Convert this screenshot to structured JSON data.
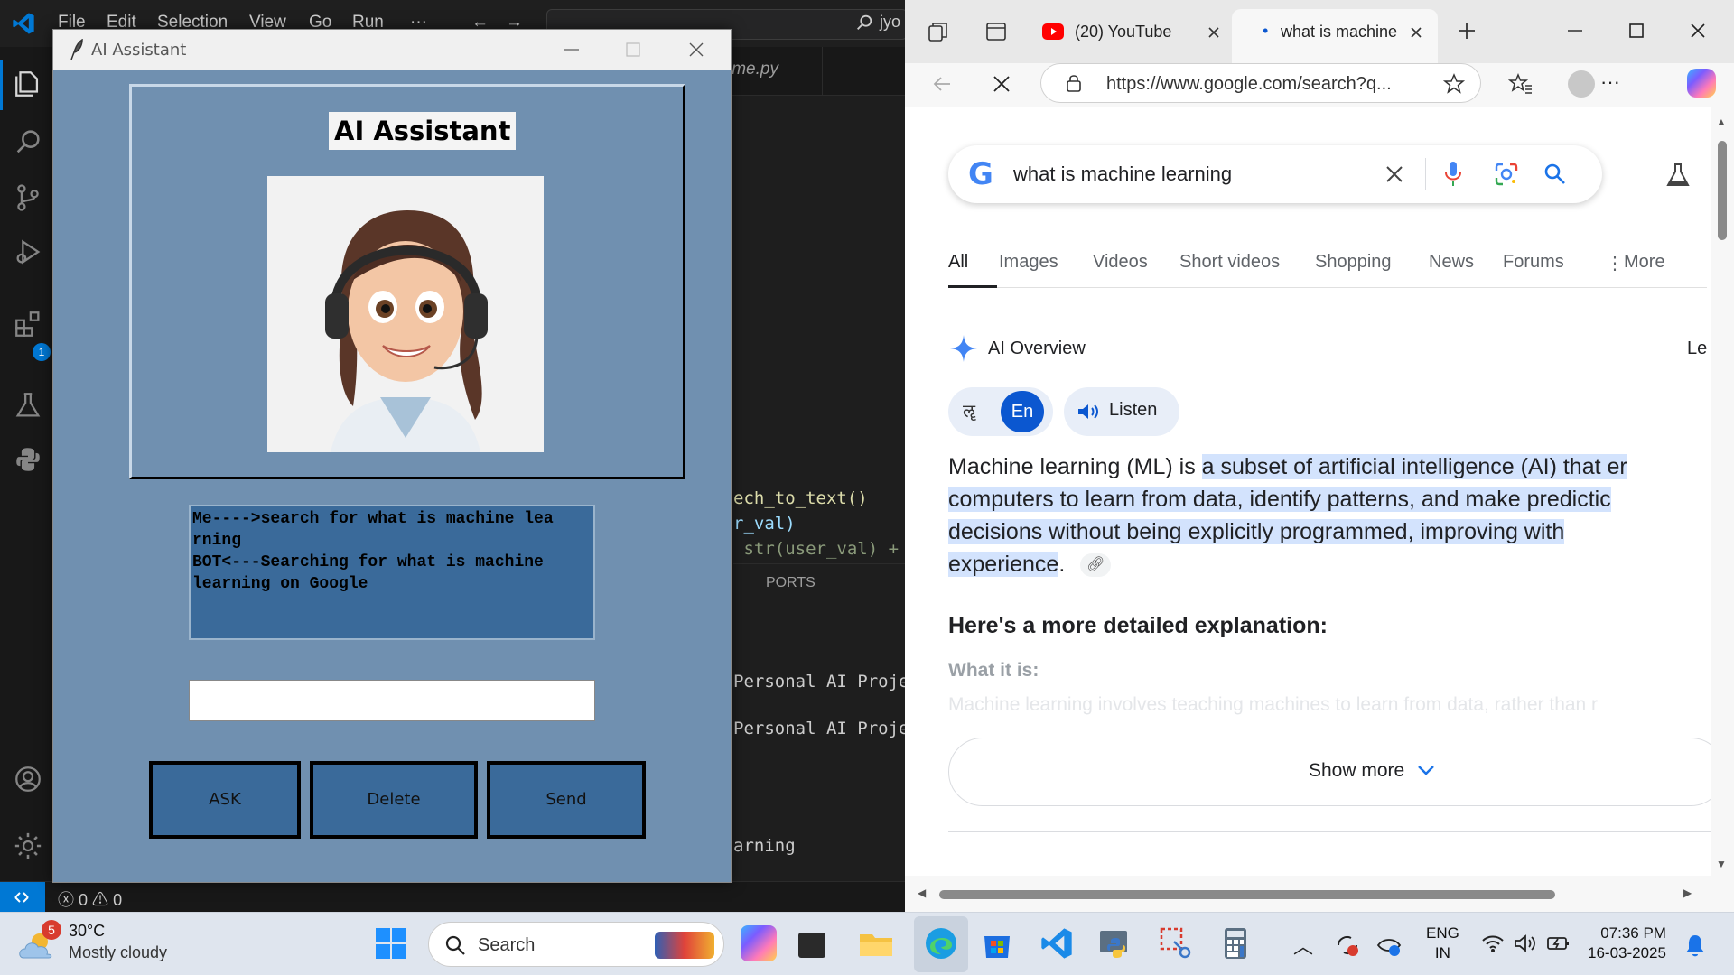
{
  "vscode": {
    "menu": [
      "File",
      "Edit",
      "Selection",
      "View",
      "Go",
      "Run",
      "···"
    ],
    "search_text": "jyo",
    "tab_file": "ime.py",
    "extensions_badge": "1",
    "code_lines": [
      {
        "text": "ech_to_text()",
        "color": "#dcdcaa"
      },
      {
        "text": "r_val)",
        "color": "#9cdcfe"
      },
      {
        "text": " str(user_val) +",
        "color": "#8a9a7a"
      }
    ],
    "panel_tab": "PORTS",
    "terminal_lines": [
      "Personal AI Projec",
      "Personal AI Projec",
      "arning"
    ],
    "status_errors": "0",
    "status_warnings": "0"
  },
  "ai_app": {
    "window_title": "AI Assistant",
    "heading": "AI Assistant",
    "chat_log": "Me---->search for what is machine lea\nrning\nBOT<---Searching for what is machine\nlearning on Google",
    "input_value": "",
    "buttons": {
      "ask": "ASK",
      "delete": "Delete",
      "send": "Send"
    }
  },
  "browser": {
    "tabs": [
      {
        "label": "(20) YouTube"
      },
      {
        "label": "what is machine"
      }
    ],
    "url": "https://www.google.com/search?q...",
    "search_query": "what is machine learning",
    "search_tabs": [
      "All",
      "Images",
      "Videos",
      "Short videos",
      "Shopping",
      "News",
      "Forums",
      "More"
    ],
    "ai_overview_title": "AI Overview",
    "ai_overview_right": "Le",
    "lang_en": "En",
    "listen": "Listen",
    "ml_plain_1": "Machine learning (ML) is ",
    "ml_hl_1": "a subset of artificial intelligence (AI) that er",
    "ml_hl_2": "computers to learn from data, identify patterns, and make predictic",
    "ml_hl_3": "decisions without being explicitly programmed, improving with",
    "ml_hl_4": "experience",
    "ml_end": ".",
    "detail_heading": "Here's a more detailed explanation:",
    "what_it_is": "What it is:",
    "faded_text": "Machine learning involves teaching machines to learn from data, rather than r",
    "show_more": "Show more"
  },
  "taskbar": {
    "weather_badge": "5",
    "temperature": "30°C",
    "weather": "Mostly cloudy",
    "search_label": "Search",
    "lang_line1": "ENG",
    "lang_line2": "IN",
    "time": "07:36 PM",
    "date": "16-03-2025"
  },
  "colors": {
    "vscode_accent": "#0078d4",
    "ai_bg": "#7090b0",
    "ai_button": "#3a6a9a",
    "google_blue": "#0b57d0",
    "highlight": "#d3e3fd"
  }
}
